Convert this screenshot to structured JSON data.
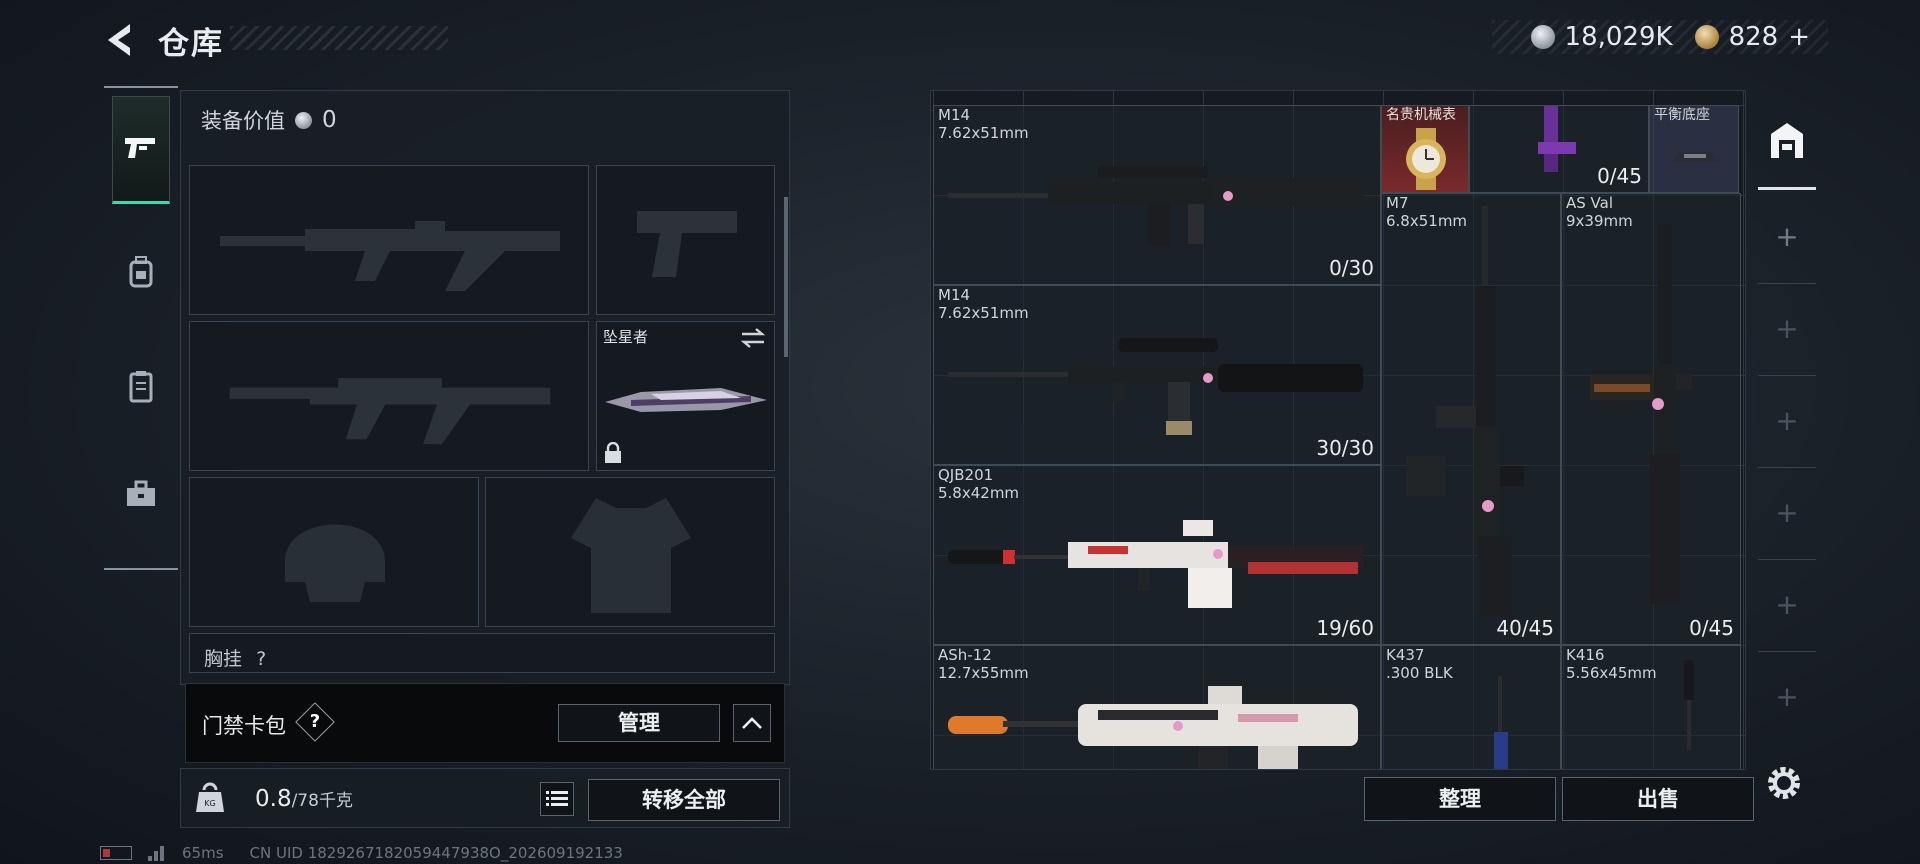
{
  "header": {
    "title": "仓库",
    "currency_silver": "18,029K",
    "currency_gold": "828",
    "currency_gold_plus": "+"
  },
  "left_panel": {
    "equip_value_label": "装备价值",
    "equip_value": "0",
    "melee_slot_name": "坠星者",
    "chest_rig_label": "胸挂",
    "chest_rig_value": "?",
    "card_bag_label": "门禁卡包",
    "help_mark": "?",
    "manage_label": "管理",
    "weight_value": "0.8",
    "weight_max": "/78千克",
    "transfer_all_label": "转移全部"
  },
  "status": {
    "ping": "65ms",
    "uid": "CN UID 1829267182059447938O_202609192133"
  },
  "stash": {
    "items": [
      {
        "name": "M14",
        "caliber": "7.62x51mm",
        "ammo": "0/30"
      },
      {
        "name": "M14",
        "caliber": "7.62x51mm",
        "ammo": "30/30"
      },
      {
        "name": "QJB201",
        "caliber": "5.8x42mm",
        "ammo": "19/60"
      },
      {
        "name": "ASh-12",
        "caliber": "12.7x55mm",
        "ammo": ""
      },
      {
        "name": "名贵机械表",
        "caliber": "",
        "ammo": ""
      },
      {
        "name": "",
        "caliber": "",
        "ammo": "0/45"
      },
      {
        "name": "平衡底座",
        "caliber": "",
        "ammo": ""
      },
      {
        "name": "M7",
        "caliber": "6.8x51mm",
        "ammo": "40/45"
      },
      {
        "name": "AS Val",
        "caliber": "9x39mm",
        "ammo": "0/45"
      },
      {
        "name": "K437",
        "caliber": ".300 BLK",
        "ammo": ""
      },
      {
        "name": "K416",
        "caliber": "5.56x45mm",
        "ammo": ""
      }
    ],
    "sort_label": "整理",
    "sell_label": "出售"
  },
  "colors": {
    "accent_green": "#42d6a8",
    "pink_charm": "#e59ac8",
    "orange_tip": "#e07a2a"
  },
  "icons": [
    "back-icon",
    "pistol-icon",
    "backpack-icon",
    "armor-icon",
    "toolbox-icon",
    "weight-icon",
    "list-icon",
    "lock-icon",
    "swap-icon",
    "chevron-up-icon",
    "settings-icon",
    "stash-tab-icon",
    "add-icon"
  ]
}
